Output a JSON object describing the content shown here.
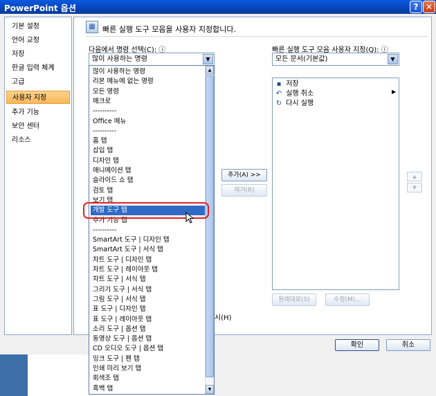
{
  "window": {
    "title": "PowerPoint 옵션",
    "help_glyph": "?",
    "close_glyph": "✕"
  },
  "sidebar": {
    "items": [
      "기본 설정",
      "언어 교정",
      "저장",
      "한글 입력 체계",
      "고급",
      "사용자 지정",
      "추가 기능",
      "보안 센터",
      "리소스"
    ],
    "selected_index": 5
  },
  "header": {
    "text": "빠른 실행 도구 모음을 사용자 지정합니다.",
    "icon": "customize-toolbar-icon"
  },
  "commands": {
    "label": "다음에서 명령 선택(C):",
    "info_glyph": "ⓘ",
    "selected_value": "많이 사용하는 명령",
    "dropdown_items": [
      "많이 사용하는 명령",
      "리본 메뉴에 없는 명령",
      "모든 명령",
      "매크로",
      "----------",
      "Office 메뉴",
      "----------",
      "홈 탭",
      "삽입 탭",
      "디자인 탭",
      "애니메이션 탭",
      "슬라이드 쇼 탭",
      "검토 탭",
      "보기 탭",
      "개발 도구 탭",
      "추가 기능 탭",
      "----------",
      "SmartArt 도구 | 디자인 탭",
      "SmartArt 도구 | 서식 탭",
      "차트 도구 | 디자인 탭",
      "차트 도구 | 레이아웃 탭",
      "차트 도구 | 서식 탭",
      "그리기 도구 | 서식 탭",
      "그림 도구 | 서식 탭",
      "표 도구 | 디자인 탭",
      "표 도구 | 레이아웃 탭",
      "소리 도구 | 옵션 탭",
      "동영상 도구 | 옵션 탭",
      "CD 오디오 도구 | 옵션 탭",
      "잉크 도구 | 펜 탭",
      "인쇄 미리 보기 탭",
      "회색조 탭",
      "흑백 탭"
    ],
    "highlighted_index": 14
  },
  "quick_access": {
    "label": "빠른 실행 도구 모음 사용자 지정(Q):",
    "info_glyph": "ⓘ",
    "selected_value": "모든 문서(기본값)",
    "items": [
      {
        "label": "저장",
        "icon": "save-icon"
      },
      {
        "label": "실행 취소",
        "icon": "undo-icon",
        "has_submenu": true
      },
      {
        "label": "다시 실행",
        "icon": "redo-icon"
      }
    ]
  },
  "buttons": {
    "add": "추가(A) >>",
    "remove": "제거(R)",
    "reset": "원래대로(S)",
    "modify": "수정(M)...",
    "ok": "확인",
    "cancel": "취소",
    "move_up_glyph": "▲",
    "move_down_glyph": "▼",
    "dropdown_glyph": "▼",
    "submenu_glyph": "▶"
  },
  "partial_checkbox_label_fragment": "시(H)",
  "colors": {
    "titlebar": "#0844b8",
    "selection": "#316ac5",
    "sidebar_selected": "#f7b85a",
    "annotation_ring": "#e02020"
  }
}
